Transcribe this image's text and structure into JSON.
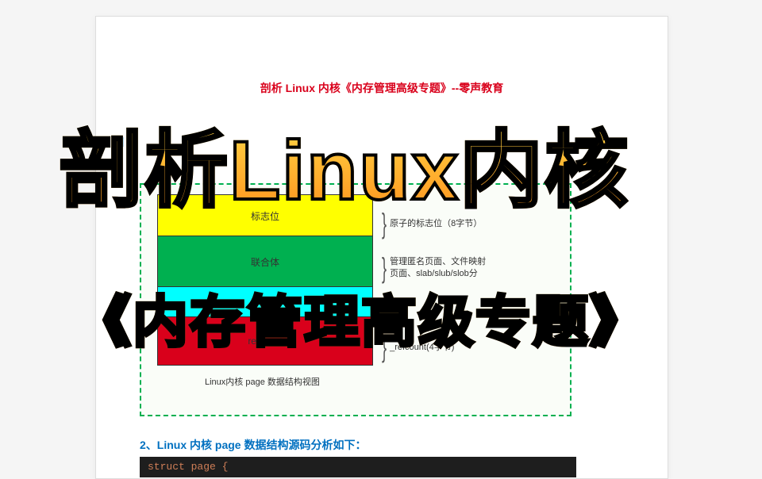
{
  "doc": {
    "red_title": "剖析 Linux 内核《内存管理高级专题》--零声教育",
    "blocks": {
      "yellow": "标志位",
      "green": "联合体",
      "red": "refcount"
    },
    "annotations": {
      "a1": "原子的标志位（8字节）",
      "a2": "管理匿名页面、文件映射\n页面、slab/slub/slob分",
      "a3": "_refcount(4字节)"
    },
    "caption": "Linux内核 page 数据结构视图",
    "sub_title": "2、Linux 内核 page 数据结构源码分析如下：",
    "code": "struct page {"
  },
  "overlay": {
    "line1": "剖析Linux内核",
    "line2": "《内存管理高级专题》"
  }
}
